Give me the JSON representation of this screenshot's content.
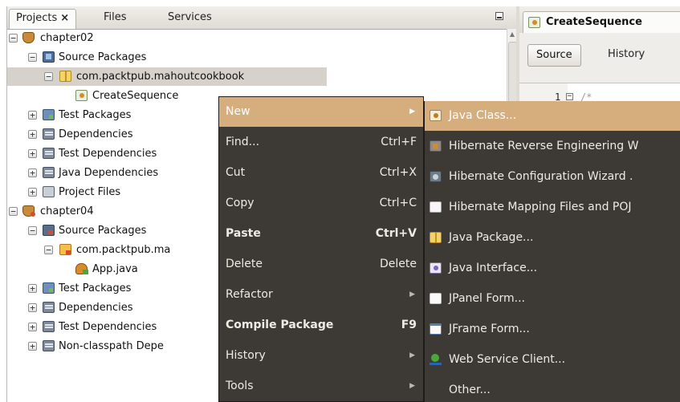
{
  "projects_panel": {
    "tabs": [
      {
        "label": "Projects",
        "close": "×"
      },
      {
        "label": "Files"
      },
      {
        "label": "Services"
      }
    ],
    "tree": [
      {
        "label": "chapter02",
        "expander": "−"
      },
      {
        "label": "Source Packages",
        "expander": "−"
      },
      {
        "label": "com.packtpub.mahoutcookbook",
        "expander": "−"
      },
      {
        "label": "CreateSequence"
      },
      {
        "label": "Test Packages",
        "expander": "+"
      },
      {
        "label": "Dependencies",
        "expander": "+"
      },
      {
        "label": "Test Dependencies",
        "expander": "+"
      },
      {
        "label": "Java Dependencies",
        "expander": "+"
      },
      {
        "label": "Project Files",
        "expander": "+"
      },
      {
        "label": "chapter04",
        "expander": "−"
      },
      {
        "label": "Source Packages",
        "expander": "−"
      },
      {
        "label": "com.packtpub.ma",
        "expander": "−"
      },
      {
        "label": "App.java"
      },
      {
        "label": "Test Packages",
        "expander": "+"
      },
      {
        "label": "Dependencies",
        "expander": "+"
      },
      {
        "label": "Test Dependencies",
        "expander": "+"
      },
      {
        "label": "Non-classpath Depe",
        "expander": "+"
      }
    ]
  },
  "editor": {
    "tab_title": "CreateSequence",
    "source_button": "Source",
    "history_button": "History",
    "line_number": "1",
    "fold": "−",
    "code_start": "/*"
  },
  "context_menu": {
    "items": [
      {
        "label": "New",
        "arrow": "▶"
      },
      {
        "label": "Find...",
        "shortcut": "Ctrl+F"
      },
      {
        "label": "Cut",
        "shortcut": "Ctrl+X"
      },
      {
        "label": "Copy",
        "shortcut": "Ctrl+C"
      },
      {
        "label": "Paste",
        "shortcut": "Ctrl+V"
      },
      {
        "label": "Delete",
        "shortcut": "Delete"
      },
      {
        "label": "Refactor",
        "arrow": "▶"
      },
      {
        "label": "Compile Package",
        "shortcut": "F9"
      },
      {
        "label": "History",
        "arrow": "▶"
      },
      {
        "label": "Tools",
        "arrow": "▶"
      }
    ]
  },
  "submenu": {
    "items": [
      {
        "label": "Java Class...",
        "icon": "java-class-icon"
      },
      {
        "label": "Hibernate Reverse Engineering W",
        "icon": "hibernate-icon"
      },
      {
        "label": "Hibernate Configuration Wizard .",
        "icon": "hibernate-config-icon"
      },
      {
        "label": "Hibernate Mapping Files and POJ",
        "icon": "document-icon"
      },
      {
        "label": "Java Package...",
        "icon": "java-package-icon"
      },
      {
        "label": "Java Interface...",
        "icon": "java-interface-icon"
      },
      {
        "label": "JPanel Form...",
        "icon": "jpanel-icon"
      },
      {
        "label": "JFrame Form...",
        "icon": "jframe-icon"
      },
      {
        "label": "Web Service Client...",
        "icon": "web-service-icon"
      },
      {
        "label": "Other..."
      }
    ]
  },
  "colors": {
    "menu_bg": "#3d3a36",
    "menu_highlight": "#d6ae7e",
    "selection": "#d6d2cb"
  }
}
